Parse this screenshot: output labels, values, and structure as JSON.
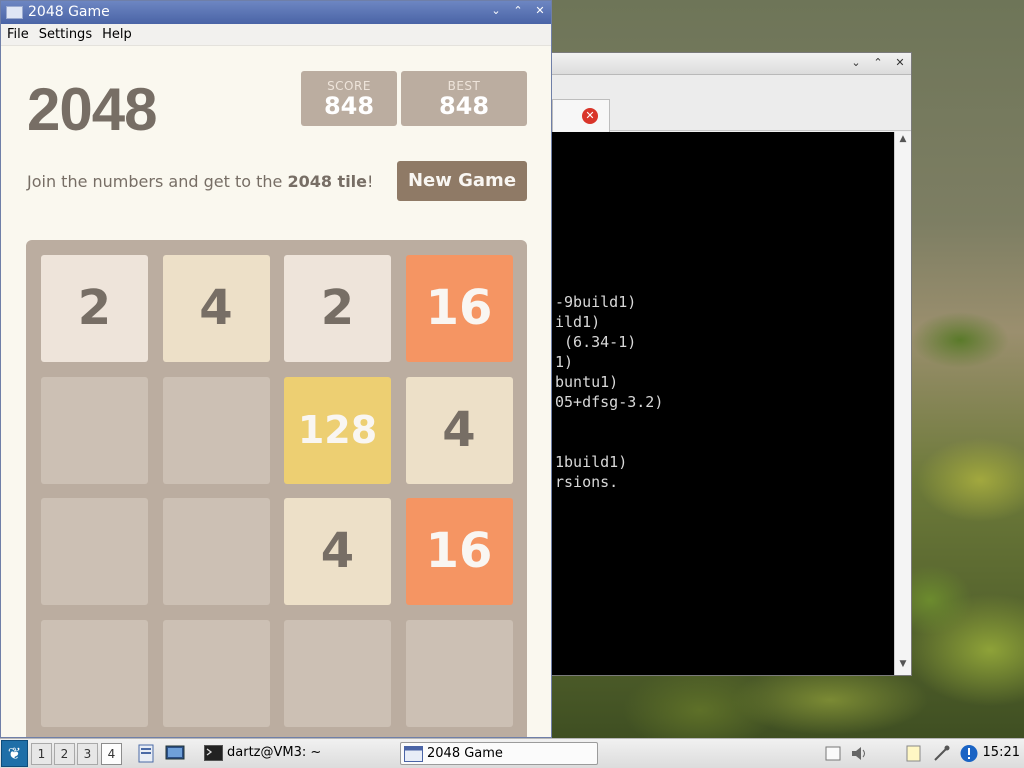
{
  "game_window": {
    "title": "2048 Game",
    "menu": [
      "File",
      "Settings",
      "Help"
    ],
    "heading": "2048",
    "score_label": "SCORE",
    "score_value": "848",
    "best_label": "BEST",
    "best_value": "848",
    "intro_prefix": "Join the numbers and get to the ",
    "intro_bold": "2048 tile",
    "intro_suffix": "!",
    "new_game_label": "New Game",
    "board": [
      [
        "2",
        "4",
        "2",
        "16"
      ],
      [
        "",
        "",
        "128",
        "4"
      ],
      [
        "",
        "",
        "4",
        "16"
      ],
      [
        "",
        "",
        "",
        ""
      ]
    ]
  },
  "terminal_window": {
    "tab_close_glyph": "✕",
    "lines": [
      "-9build1)",
      "ild1)",
      " (6.34-1)",
      "1)",
      "buntu1)",
      "05+dfsg-3.2)",
      "",
      "",
      "1build1)",
      "rsions."
    ]
  },
  "taskbar": {
    "workspaces": [
      "1",
      "2",
      "3",
      "4"
    ],
    "active_workspace": "4",
    "tasks": [
      {
        "label": "dartz@VM3: ~",
        "icon": "terminal-icon"
      },
      {
        "label": "2048 Game",
        "icon": "window-icon"
      }
    ],
    "clock": "15:21"
  },
  "colors": {
    "tile_2": "#eee4da",
    "tile_4": "#ede0c8",
    "tile_16": "#f59563",
    "tile_128": "#edcf72",
    "board": "#bbada0",
    "button": "#8f7a66",
    "titlebar": "#4a64a6"
  }
}
